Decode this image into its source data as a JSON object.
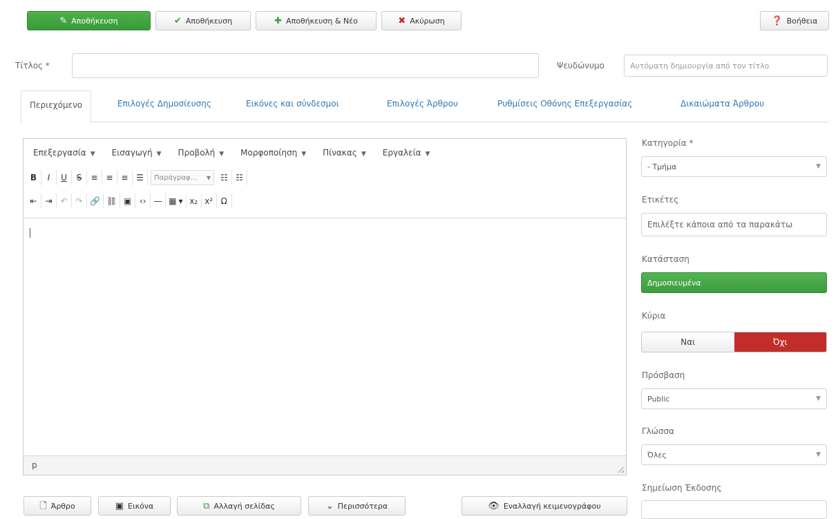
{
  "toolbar": {
    "save": "Αποθήκευση",
    "save_close": "Αποθήκευση",
    "save_new": "Αποθήκευση & Νέο",
    "cancel": "Ακύρωση",
    "help": "Βοήθεια"
  },
  "title_field": {
    "label": "Τίτλος *",
    "value": ""
  },
  "alias_field": {
    "label": "Ψευδώνυμο",
    "placeholder": "Αυτόματη δημιουργία από τον τίτλο"
  },
  "tabs": [
    {
      "label": "Περιεχόμενο"
    },
    {
      "label": "Επιλογές Δημοσίευσης"
    },
    {
      "label": "Εικόνες και σύνδεσμοι"
    },
    {
      "label": "Επιλογές Άρθρου"
    },
    {
      "label": "Ρυθμίσεις Οθόνης Επεξεργασίας"
    },
    {
      "label": "Δικαιώματα Άρθρου"
    }
  ],
  "editor": {
    "menus": [
      {
        "label": "Επεξεργασία"
      },
      {
        "label": "Εισαγωγή"
      },
      {
        "label": "Προβολή"
      },
      {
        "label": "Μορφοποίηση"
      },
      {
        "label": "Πίνακας"
      },
      {
        "label": "Εργαλεία"
      }
    ],
    "format_select": "Παράγραφ...",
    "path": "p"
  },
  "bottom_buttons": {
    "article": "Άρθρο",
    "image": "Εικόνα",
    "pagebreak": "Αλλαγή σελίδας",
    "readmore": "Περισσότερα",
    "toggle_editor": "Εναλλαγή κειμενογράφου"
  },
  "sidebar": {
    "category": {
      "label": "Κατηγορία *",
      "value": "- Τμήμα"
    },
    "tags": {
      "label": "Ετικέτες",
      "placeholder": "Επιλέξτε κάποια από τα παρακάτω"
    },
    "status": {
      "label": "Κατάσταση",
      "value": "Δημοσιευμένα"
    },
    "featured": {
      "label": "Κύρια",
      "yes": "Ναι",
      "no": "Όχι"
    },
    "access": {
      "label": "Πρόσβαση",
      "value": "Public"
    },
    "language": {
      "label": "Γλώσσα",
      "value": "Όλες"
    },
    "version_note": {
      "label": "Σημείωση Έκδοσης"
    }
  },
  "colors": {
    "primary": "#3a9a3a",
    "danger": "#c12e2a",
    "link": "#2a78b8"
  }
}
